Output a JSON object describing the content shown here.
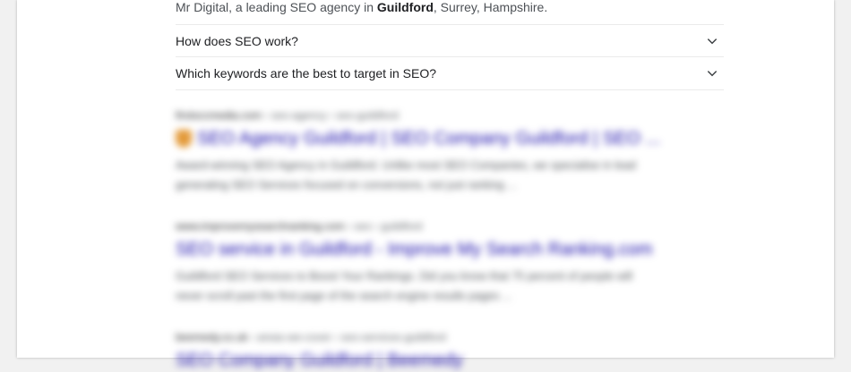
{
  "snippet": {
    "tail_before": "Mr Digital, a leading SEO agency in ",
    "tail_bold": "Guildford",
    "tail_after": ", Surrey, Hampshire."
  },
  "faq": [
    {
      "question": "How does SEO work?",
      "icon": "chevron-down-icon"
    },
    {
      "question": "Which keywords are the best to target in SEO?",
      "icon": "chevron-down-icon"
    }
  ],
  "results": [
    {
      "domain": "firstsccmedia.com",
      "breadcrumb": " › seo-agency › seo-guildford",
      "title": "SEO Agency Guildford | SEO Company Guildford | SEO ...",
      "has_favicon": true,
      "favicon_color": "#e39a3a",
      "desc_lines": [
        "Award-winning SEO Agency in Guildford. Unlike most SEO Companies, we specialise in lead",
        "generating SEO Services focused on conversions, not just ranking ..."
      ]
    },
    {
      "domain": "www.improvemysearchranking.com",
      "breadcrumb": " › seo › guildford",
      "title": "SEO service in Guildford - Improve My Search Ranking.com",
      "has_favicon": false,
      "desc_lines": [
        "Guildford SEO Services to Boost Your Rankings. Did you know that 75 percent of people will",
        "never scroll past the first page of the search engine results pages ..."
      ]
    },
    {
      "domain": "beemedy.co.uk",
      "breadcrumb": " › areas-we-cover › seo-services-guildford",
      "title": "SEO Company Guildford | Beemedy",
      "has_favicon": false,
      "desc_lines": [
        ""
      ]
    }
  ],
  "colors": {
    "link": "#1a0dab",
    "text": "#202124",
    "muted": "#4d5156",
    "divider": "#ebebeb"
  }
}
